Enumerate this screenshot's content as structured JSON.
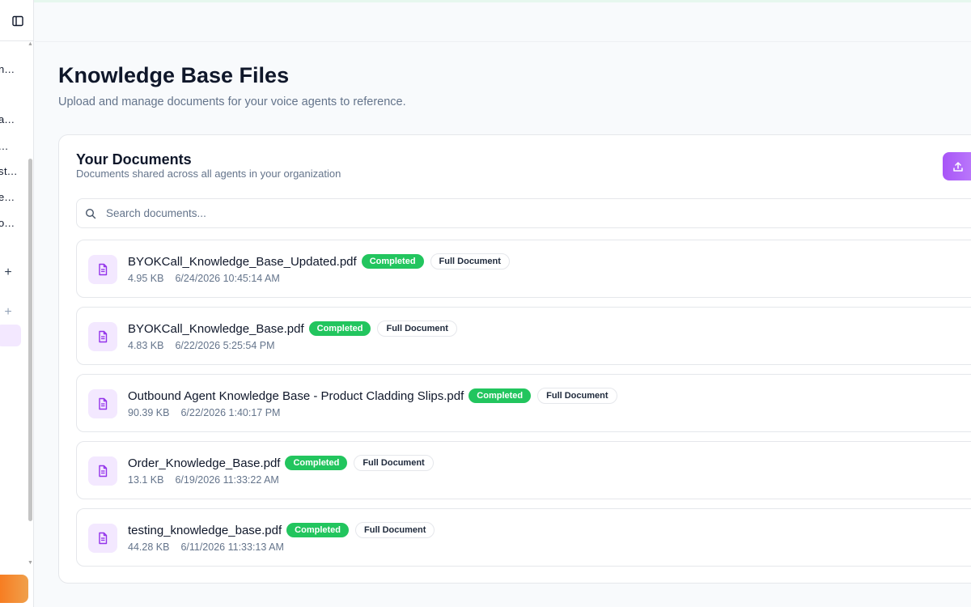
{
  "sidebar": {
    "nav_items": [
      "n...",
      "a...",
      "...",
      "st...",
      "e...",
      "o..."
    ],
    "plus_labels": [
      "+",
      "+"
    ]
  },
  "page": {
    "title": "Knowledge Base Files",
    "subtitle": "Upload and manage documents for your voice agents to reference."
  },
  "card": {
    "title": "Your Documents",
    "subtitle": "Documents shared across all agents in your organization"
  },
  "search": {
    "placeholder": "Search documents..."
  },
  "documents": [
    {
      "name": "BYOKCall_Knowledge_Base_Updated.pdf",
      "status": "Completed",
      "scope": "Full Document",
      "size": "4.95 KB",
      "date": "6/24/2026 10:45:14 AM"
    },
    {
      "name": "BYOKCall_Knowledge_Base.pdf",
      "status": "Completed",
      "scope": "Full Document",
      "size": "4.83 KB",
      "date": "6/22/2026 5:25:54 PM"
    },
    {
      "name": "Outbound Agent Knowledge Base - Product Cladding Slips.pdf",
      "status": "Completed",
      "scope": "Full Document",
      "size": "90.39 KB",
      "date": "6/22/2026 1:40:17 PM"
    },
    {
      "name": "Order_Knowledge_Base.pdf",
      "status": "Completed",
      "scope": "Full Document",
      "size": "13.1 KB",
      "date": "6/19/2026 11:33:22 AM"
    },
    {
      "name": "testing_knowledge_base.pdf",
      "status": "Completed",
      "scope": "Full Document",
      "size": "44.28 KB",
      "date": "6/11/2026 11:33:13 AM"
    }
  ],
  "colors": {
    "accent": "#a855f7",
    "status_completed": "#22c55e",
    "icon_bg": "#f3e8ff"
  },
  "icons": {
    "sidebar_toggle": "sidebar-toggle-icon",
    "upload": "upload-icon",
    "search": "search-icon",
    "document": "file-text-icon"
  }
}
